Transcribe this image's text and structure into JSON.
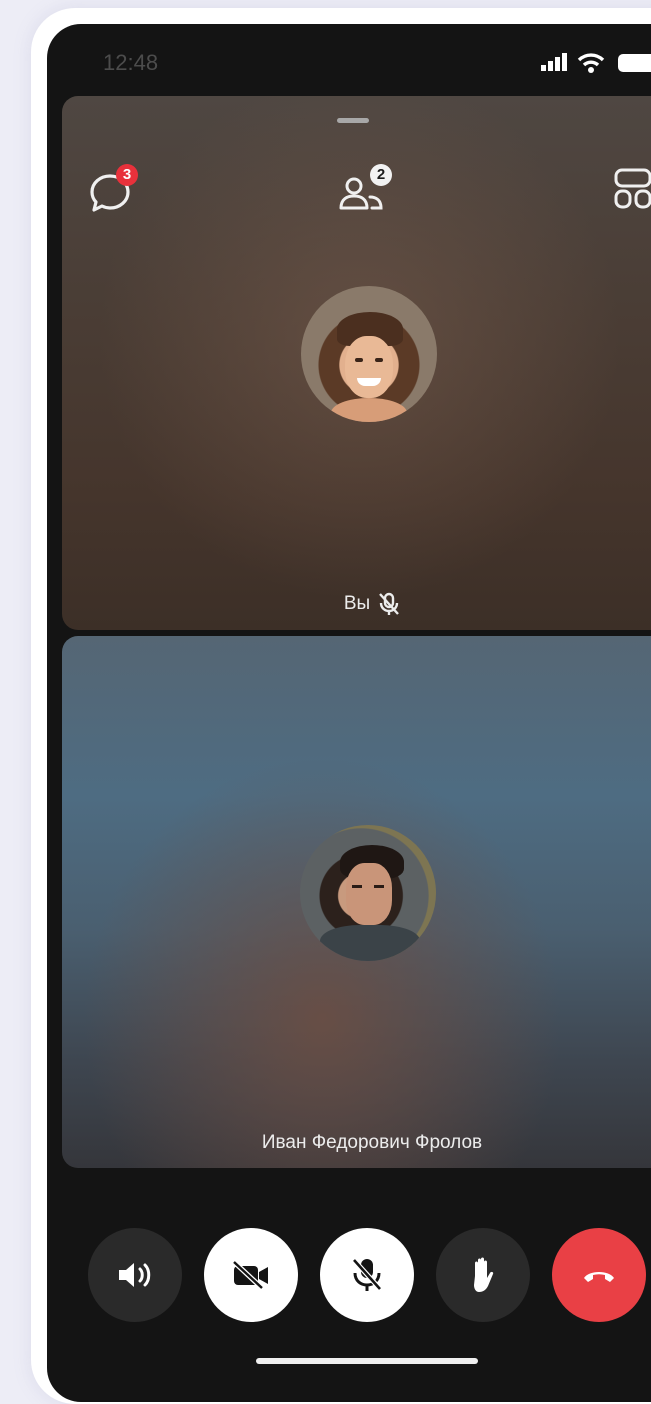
{
  "status_bar": {
    "time": "12:48"
  },
  "top_bar": {
    "chat_badge": "3",
    "participants_badge": "2"
  },
  "tiles": [
    {
      "label": "Вы",
      "mic_muted": true
    },
    {
      "label": "Иван Федорович Фролов"
    }
  ],
  "controls": [
    {
      "icon": "speaker-icon",
      "style": "dark"
    },
    {
      "icon": "camera-off-icon",
      "style": "white"
    },
    {
      "icon": "mic-off-icon",
      "style": "white"
    },
    {
      "icon": "raise-hand-icon",
      "style": "dark"
    },
    {
      "icon": "end-call-icon",
      "style": "red"
    }
  ],
  "colors": {
    "badge_red": "#e8313b",
    "end_call_red": "#e94045",
    "background": "#141414"
  }
}
